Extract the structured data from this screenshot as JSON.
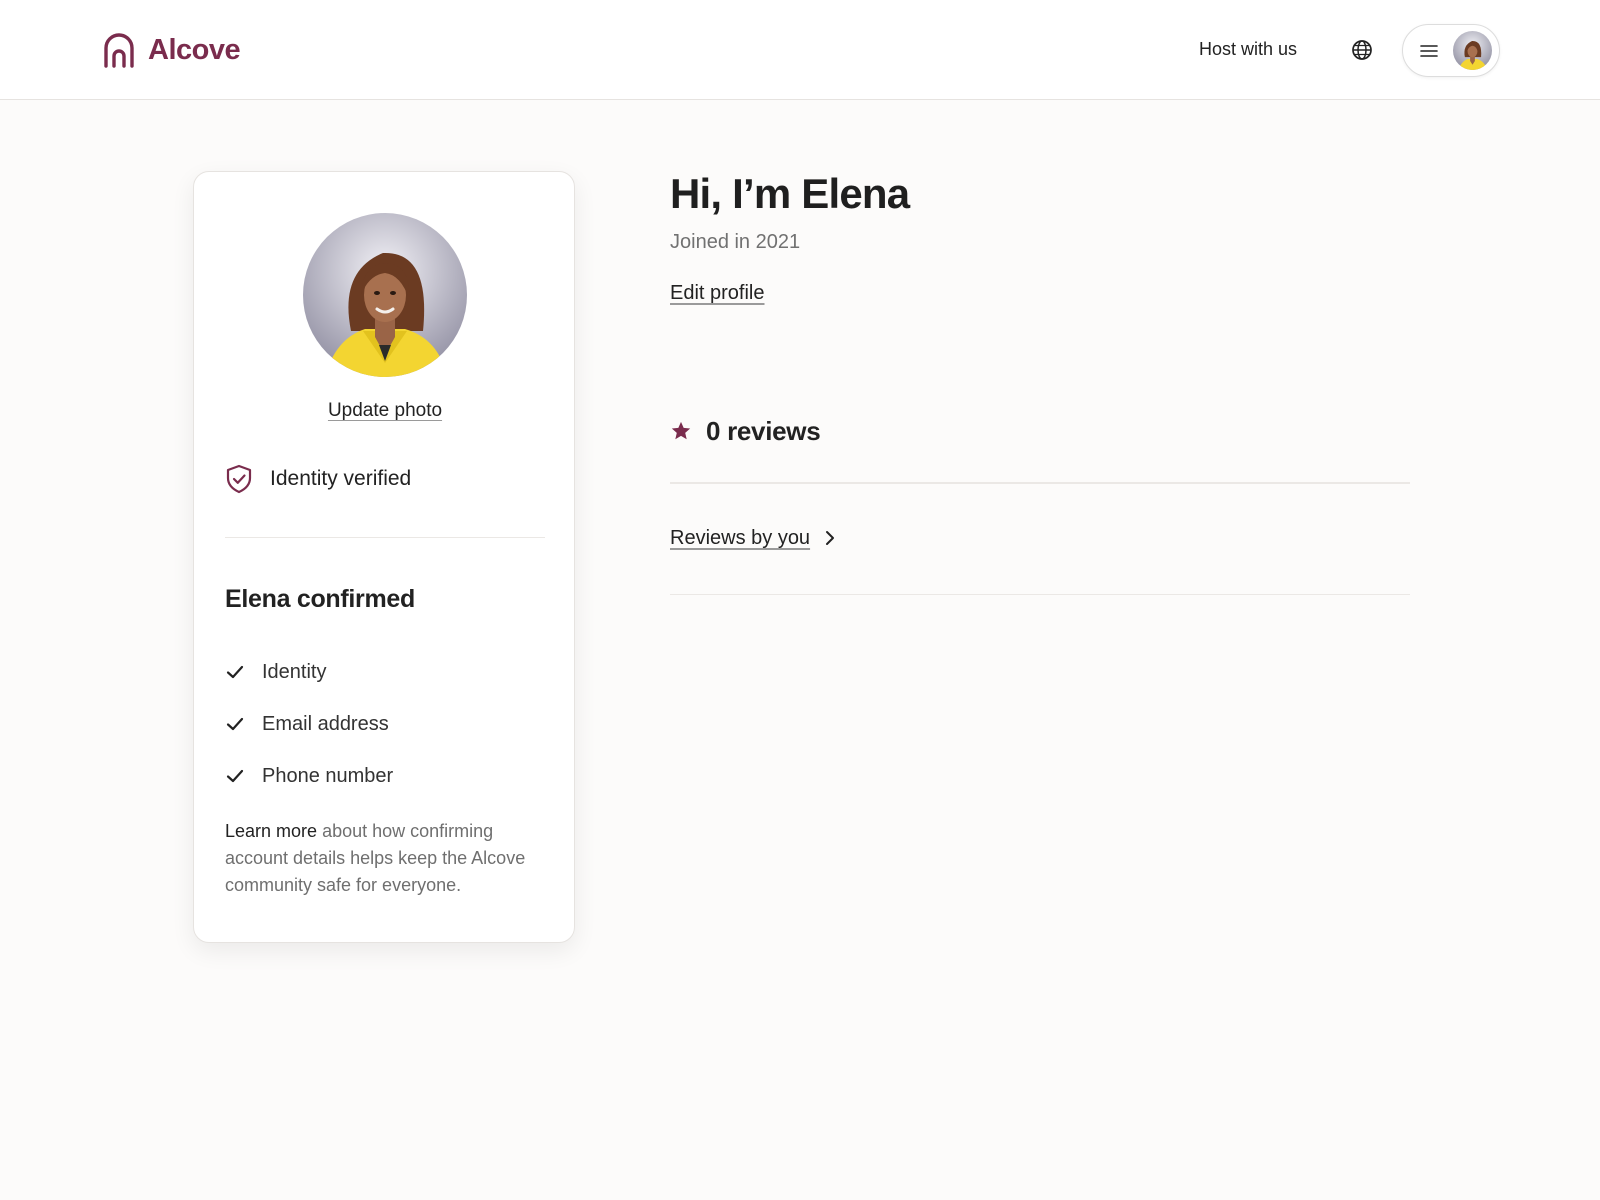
{
  "header": {
    "logo_text": "Alcove",
    "host_link": "Host with us",
    "globe_icon": "globe-icon",
    "menu_icon": "hamburger-menu-icon"
  },
  "profile_card": {
    "update_photo_label": "Update photo",
    "identity_verified_label": "Identity verified",
    "confirmed_title": "Elena confirmed",
    "confirmed_items": [
      {
        "label": "Identity"
      },
      {
        "label": "Email address"
      },
      {
        "label": "Phone number"
      }
    ],
    "learn_more_link": "Learn more",
    "learn_more_text": " about how confirming account details helps keep the Alcove community safe for everyone."
  },
  "main": {
    "greeting": "Hi, I’m Elena",
    "joined": "Joined in 2021",
    "edit_profile": "Edit profile",
    "reviews_count": "0 reviews",
    "reviews_by_you": "Reviews by you"
  },
  "colors": {
    "brand": "#7a2c4d",
    "text": "#222222",
    "muted": "#717171",
    "background": "#fcfbfa",
    "avatar_jacket": "#f3d531"
  }
}
